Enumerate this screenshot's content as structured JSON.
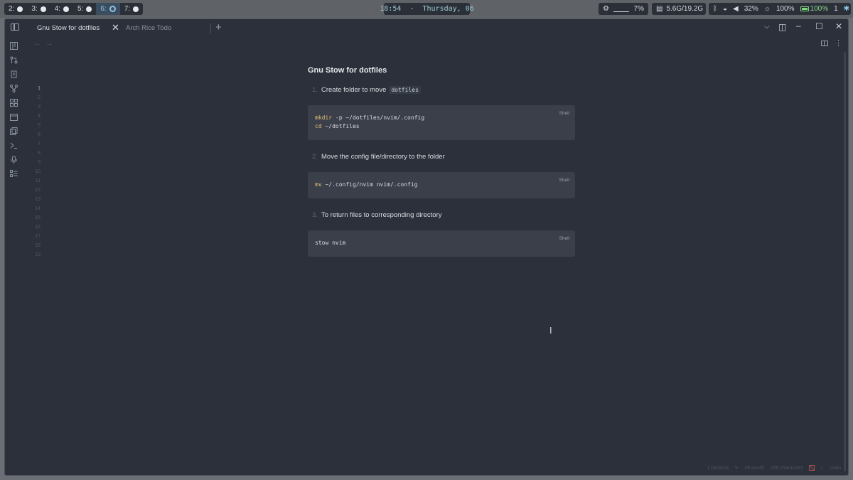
{
  "topbar": {
    "workspaces": [
      {
        "label": "2:"
      },
      {
        "label": "3:"
      },
      {
        "label": "4:"
      },
      {
        "label": "5:"
      },
      {
        "label": "6:"
      },
      {
        "label": "7:"
      }
    ],
    "clock": "18:54  -  Thursday, 06",
    "cpu": "7%",
    "memory": "5.6G/19.2G",
    "volume": "32%",
    "brightness": "100%",
    "battery": "100%",
    "notifications": "1"
  },
  "tabs": [
    {
      "label": "Gnu Stow for dotfiles"
    },
    {
      "label": "Arch Rice Todo"
    }
  ],
  "document": {
    "title": "Gnu Stow for dotfiles",
    "steps": [
      {
        "num": "1.",
        "text": "Create folder to move",
        "inline_code": "dotfiles",
        "code_lang": "Shell",
        "code_lines": [
          {
            "kw": "mkdir",
            "rest": " -p ~/dotfiles/nvim/.config"
          },
          {
            "kw": "cd",
            "rest": " ~/dotfiles"
          }
        ]
      },
      {
        "num": "2.",
        "text": "Move the config file/directory to the folder",
        "code_lang": "Shell",
        "code_lines": [
          {
            "kw": "mv",
            "rest": " ~/.config/nvim nvim/.config"
          }
        ]
      },
      {
        "num": "3.",
        "text": "To return files to corresponding directory",
        "code_lang": "Shell",
        "code_lines": [
          {
            "kw": "",
            "rest": "stow nvim"
          }
        ]
      }
    ]
  },
  "gutter": {
    "lines": [
      "1",
      "2",
      "3",
      "4",
      "5",
      "6",
      "7",
      "8",
      "9",
      "10",
      "11",
      "12",
      "13",
      "14",
      "15",
      "16",
      "17",
      "18",
      "19"
    ]
  },
  "statusbar": {
    "backlinks": "1 backlink",
    "words": "39 words",
    "characters": "259 characters",
    "branch": "main"
  },
  "colors": {
    "background": "#2b303a",
    "code_bg": "#3a3f4a",
    "keyword": "#e5c07b"
  }
}
